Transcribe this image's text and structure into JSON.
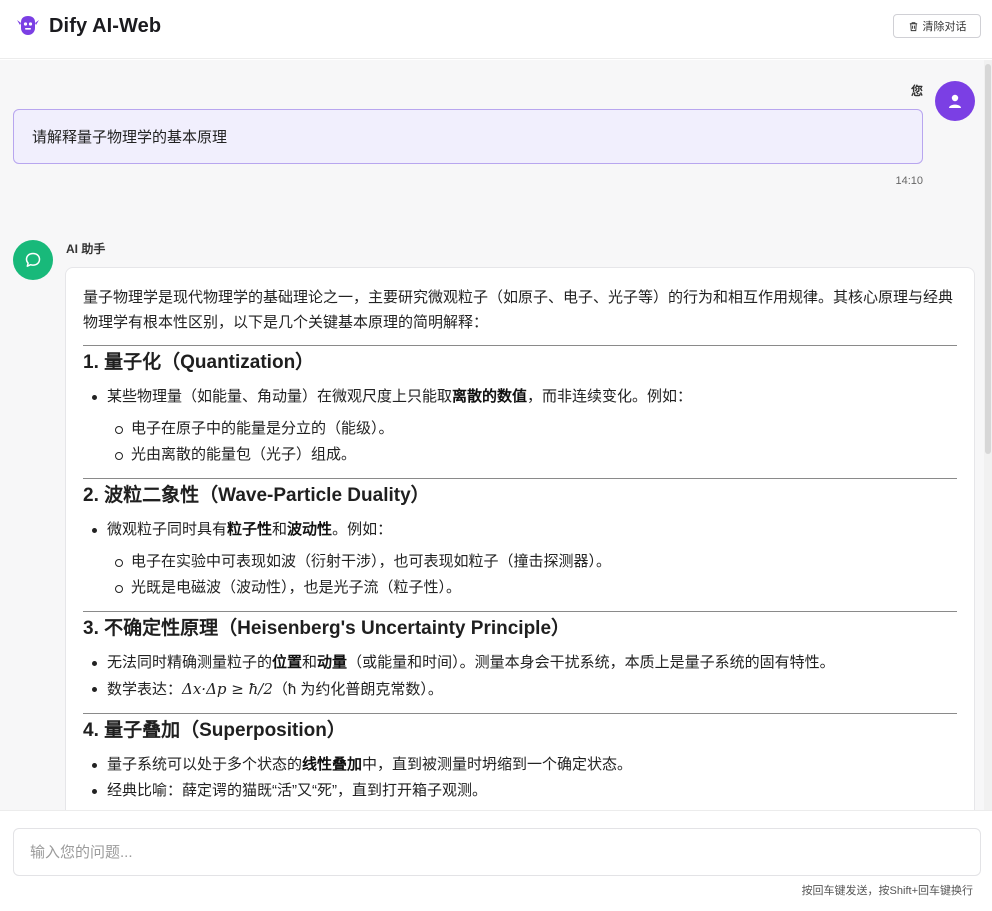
{
  "header": {
    "title": "Dify AI-Web",
    "clear_label": "清除对话"
  },
  "user_message": {
    "sender": "您",
    "text": "请解释量子物理学的基本原理",
    "time": "14:10"
  },
  "ai_message": {
    "sender": "AI 助手",
    "intro": "量子物理学是现代物理学的基础理论之一，主要研究微观粒子（如原子、电子、光子等）的行为和相互作用规律。其核心原理与经典物理学有根本性区别，以下是几个关键基本原理的简明解释：",
    "sections": [
      {
        "title": "1. 量子化（Quantization）",
        "b1_pre": "某些物理量（如能量、角动量）在微观尺度上只能取",
        "b1_bold": "离散的数值",
        "b1_post": "，而非连续变化。例如：",
        "sub1": "电子在原子中的能量是分立的（能级）。",
        "sub2": "光由离散的能量包（光子）组成。"
      },
      {
        "title": "2. 波粒二象性（Wave-Particle Duality）",
        "b1_pre": "微观粒子同时具有",
        "b1_bold1": "粒子性",
        "b1_mid": "和",
        "b1_bold2": "波动性",
        "b1_post": "。例如：",
        "sub1": "电子在实验中可表现如波（衍射干涉），也可表现如粒子（撞击探测器）。",
        "sub2": "光既是电磁波（波动性），也是光子流（粒子性）。"
      },
      {
        "title": "3. 不确定性原理（Heisenberg's Uncertainty Principle）",
        "b1_pre": "无法同时精确测量粒子的",
        "b1_bold1": "位置",
        "b1_mid": "和",
        "b1_bold2": "动量",
        "b1_post": "（或能量和时间）。测量本身会干扰系统，本质上是量子系统的固有特性。",
        "b2_pre": "数学表达：",
        "b2_math": "Δx·Δp ≥ ħ/2",
        "b2_post": "（ħ 为约化普朗克常数）。"
      },
      {
        "title": "4. 量子叠加（Superposition）",
        "b1_pre": "量子系统可以处于多个状态的",
        "b1_bold": "线性叠加",
        "b1_post": "中，直到被测量时坍缩到一个确定状态。",
        "b2": "经典比喻：薛定谔的猫既“活”又“死”，直到打开箱子观测。"
      }
    ]
  },
  "input": {
    "placeholder": "输入您的问题...",
    "hint": "按回车键发送，按Shift+回车键换行"
  },
  "colors": {
    "user_avatar": "#7b3fe4",
    "ai_avatar": "#18b97a",
    "user_bubble_bg": "#f1effd",
    "user_bubble_border": "#b8a6ef"
  }
}
